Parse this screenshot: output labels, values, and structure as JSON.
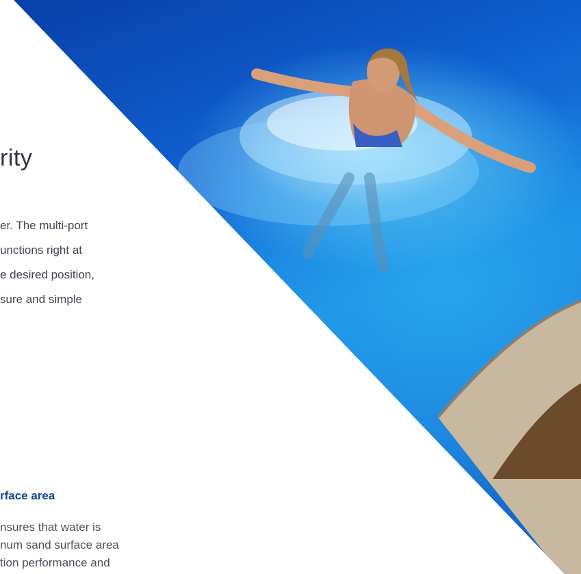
{
  "section": {
    "heading": "rity",
    "paragraph_lines": [
      "er. The multi-port",
      "unctions right at",
      "e desired position,",
      "sure and simple"
    ]
  },
  "feature": {
    "subheading": "rface area",
    "paragraph_lines": [
      "nsures that water is",
      "num sand surface area",
      "tion performance and"
    ]
  },
  "colors": {
    "heading_text": "#2d3440",
    "body_text": "#3f4652",
    "accent_blue": "#0f4a8c",
    "pool_blue": "#1c8be5"
  }
}
